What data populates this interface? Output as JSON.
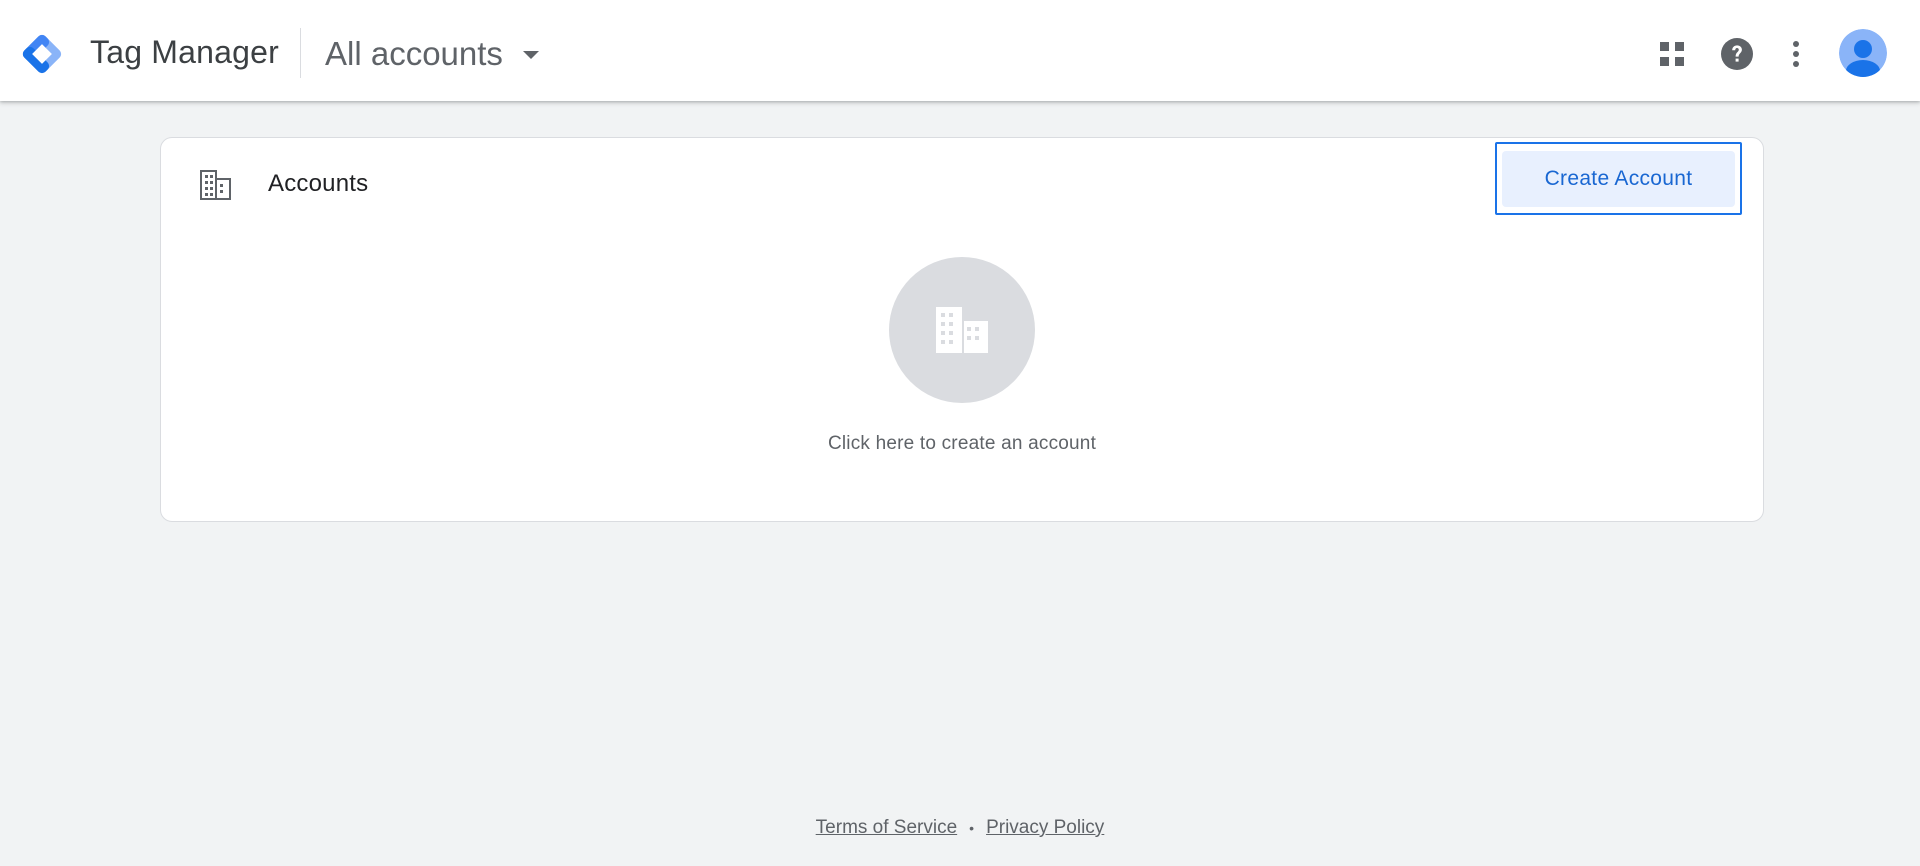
{
  "header": {
    "product_name": "Tag Manager",
    "account_switcher_label": "All accounts",
    "icons": [
      "tag-manager-logo-icon",
      "caret-down-icon",
      "apps-grid-icon",
      "help-icon",
      "more-vert-icon",
      "avatar-icon"
    ]
  },
  "card": {
    "title": "Accounts",
    "title_icon": "building-icon",
    "create_button_label": "Create Account",
    "empty_state_icon": "building-icon",
    "empty_state_text": "Click here to create an account"
  },
  "footer": {
    "terms_label": "Terms of Service",
    "separator": "•",
    "privacy_label": "Privacy Policy"
  },
  "colors": {
    "accent": "#1a73e8",
    "button_bg": "#e8f0fe",
    "page_bg": "#f1f3f4"
  }
}
